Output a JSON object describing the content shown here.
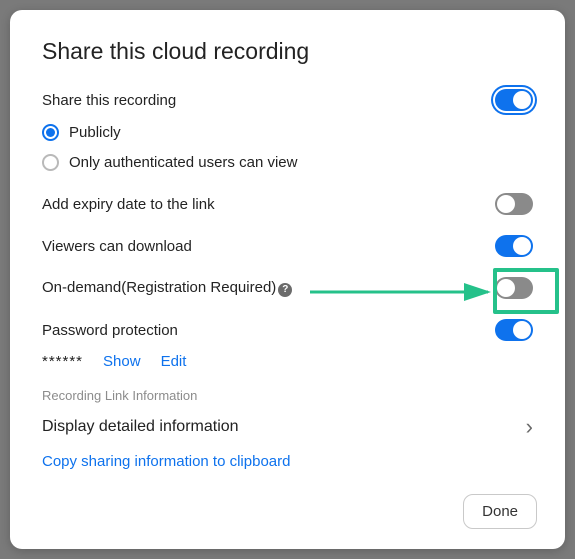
{
  "title": "Share this cloud recording",
  "share": {
    "label": "Share this recording",
    "on": true,
    "options": {
      "public": "Publicly",
      "authenticated": "Only authenticated users can view",
      "selected": "public"
    }
  },
  "expiry": {
    "label": "Add expiry date to the link",
    "on": false
  },
  "download": {
    "label": "Viewers can download",
    "on": true
  },
  "ondemand": {
    "label": "On-demand(Registration Required)",
    "on": false
  },
  "password": {
    "label": "Password protection",
    "on": true,
    "masked": "******",
    "show": "Show",
    "edit": "Edit"
  },
  "linkinfo": {
    "section": "Recording Link Information",
    "display": "Display detailed information",
    "copy": "Copy sharing information to clipboard"
  },
  "done": "Done",
  "helpGlyph": "?",
  "chevron": "›"
}
